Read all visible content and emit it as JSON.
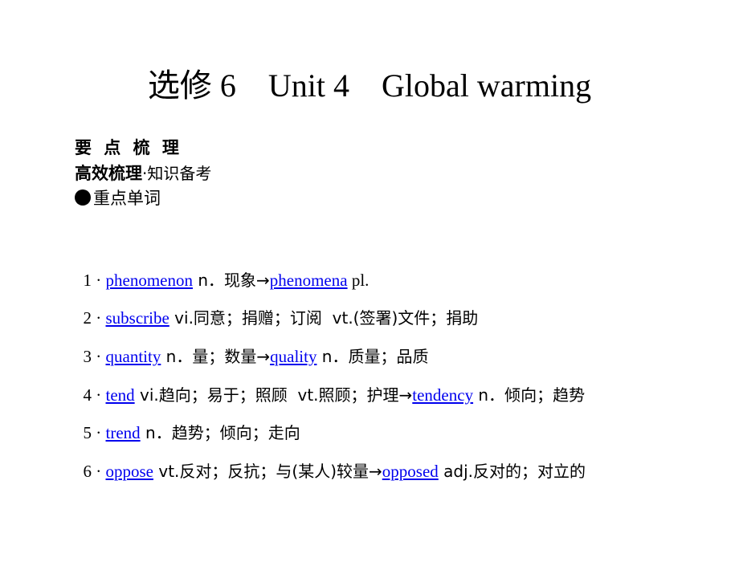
{
  "title": "选修 6　Unit 4　Global warming",
  "section": {
    "heading": "要 点 梳 理",
    "subheading_bold": "高效梳理",
    "subheading_rest": "·知识备考",
    "category": "重点单词",
    "category_icon": "bullet-circle"
  },
  "entries": [
    {
      "num": "1 · ",
      "word": "phenomenon",
      "def": " n．现象→",
      "derived": "phenomena",
      "tail": " pl."
    },
    {
      "num": "2 · ",
      "word": "subscribe",
      "def": " vi.同意；捐赠；订阅  vt.(签署)文件；捐助",
      "derived": "",
      "tail": ""
    },
    {
      "num": "3 · ",
      "word": "quantity",
      "def": " n．量；数量→",
      "derived": "quality",
      "tail": " n．质量；品质"
    },
    {
      "num": "4 · ",
      "word": "tend",
      "def": " vi.趋向；易于；照顾  vt.照顾；护理→",
      "derived": "tendency",
      "tail": " n．倾向；趋势"
    },
    {
      "num": "5 · ",
      "word": "trend",
      "def": " n．趋势；倾向；走向",
      "derived": "",
      "tail": ""
    },
    {
      "num": "6 · ",
      "word": "oppose",
      "def": " vt.反对；反抗；与(某人)较量→",
      "derived": "opposed",
      "tail": " adj.反对的；对立的"
    }
  ],
  "colors": {
    "link": "#0000ee",
    "text": "#000000"
  }
}
